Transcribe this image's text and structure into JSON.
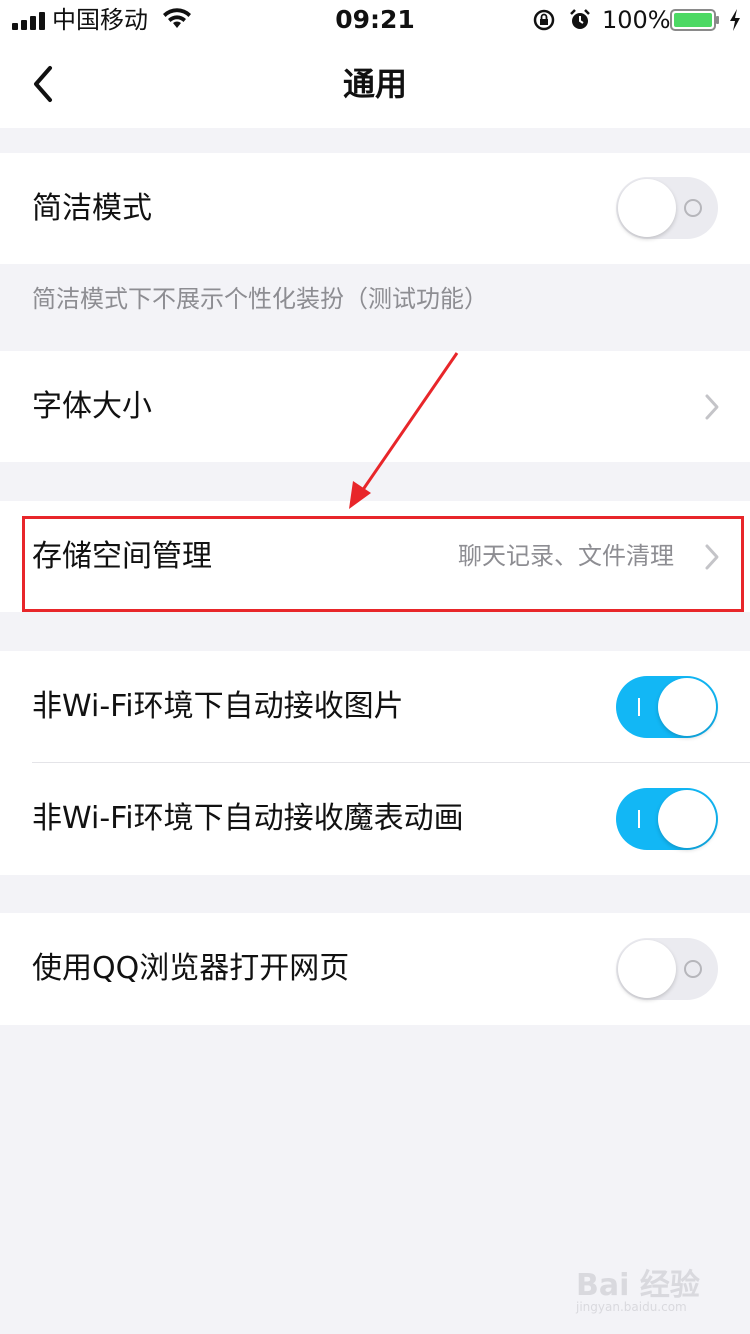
{
  "status_bar": {
    "carrier": "中国移动",
    "time": "09:21",
    "battery": "100%",
    "signal_icon": "cellular-signal-icon",
    "wifi_icon": "wifi-icon",
    "lock_icon": "rotation-lock-icon",
    "alarm_icon": "alarm-icon",
    "battery_icon": "battery-icon",
    "charging_icon": "charging-bolt-icon"
  },
  "nav": {
    "title": "通用",
    "back_icon": "chevron-left-icon"
  },
  "settings": {
    "simple_mode": {
      "label": "简洁模式",
      "on": false
    },
    "simple_mode_note": "简洁模式下不展示个性化装扮（测试功能）",
    "font_size": {
      "label": "字体大小"
    },
    "storage": {
      "label": "存储空间管理",
      "detail": "聊天记录、文件清理"
    },
    "auto_images": {
      "label": "非Wi-Fi环境下自动接收图片",
      "on": true
    },
    "auto_emoticons": {
      "label": "非Wi-Fi环境下自动接收魔表动画",
      "on": true
    },
    "qq_browser": {
      "label": "使用QQ浏览器打开网页",
      "on": false
    }
  },
  "colors": {
    "accent": "#12b7f5",
    "annotation": "#e8262a",
    "background": "#f3f3f7"
  },
  "watermark": {
    "brand": "Bai 经验",
    "url": "jingyan.baidu.com"
  }
}
